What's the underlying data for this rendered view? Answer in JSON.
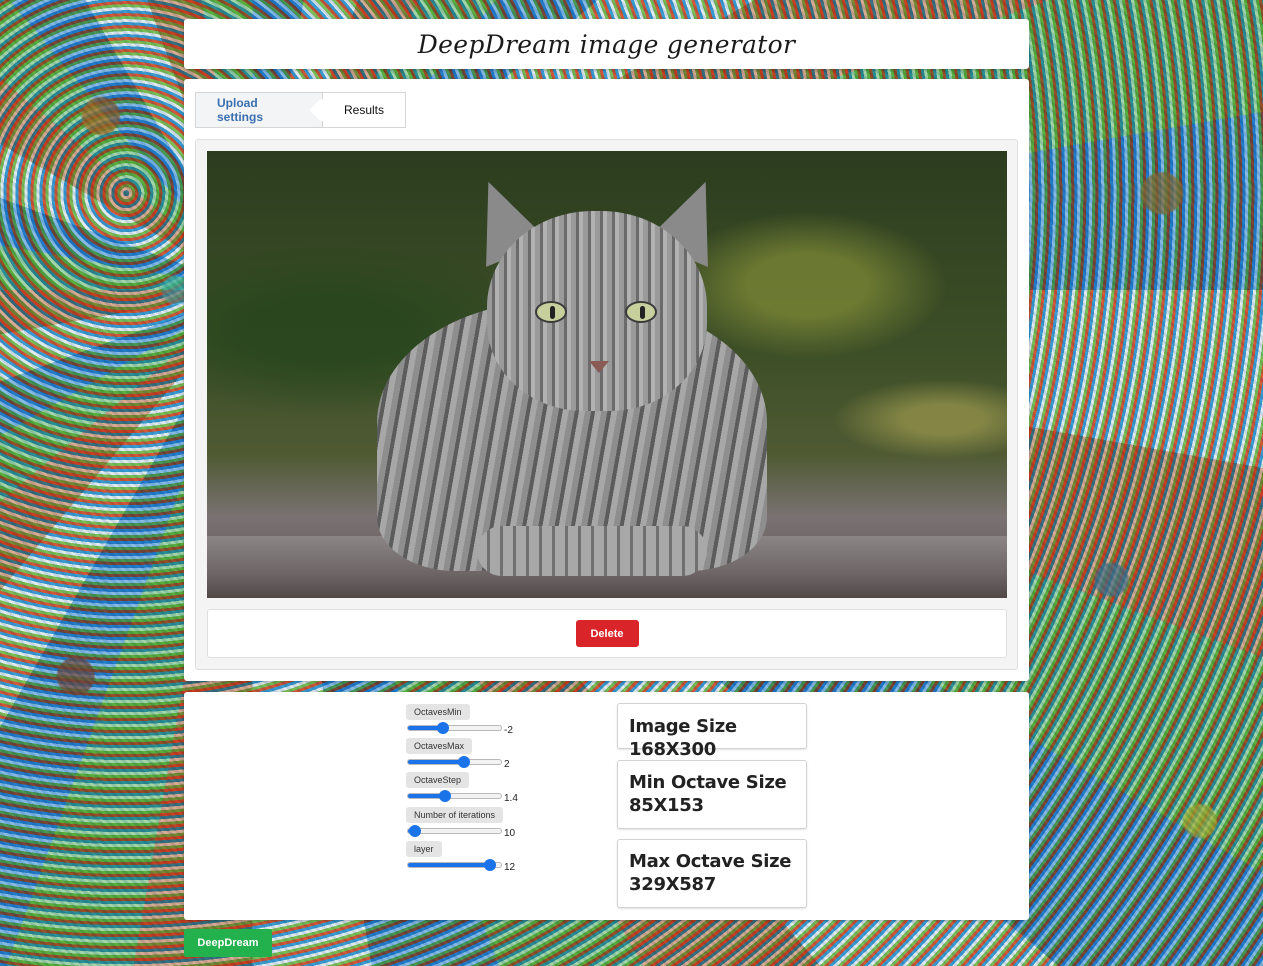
{
  "app": {
    "title": "DeepDream image generator"
  },
  "tabs": [
    {
      "label": "Upload settings",
      "active": true
    },
    {
      "label": "Results",
      "active": false
    }
  ],
  "preview": {
    "image_alt": "Tabby cat photo",
    "delete_label": "Delete"
  },
  "sliders": [
    {
      "label": "OctavesMin",
      "value": "-2",
      "fraction": 0.38
    },
    {
      "label": "OctavesMax",
      "value": "2",
      "fraction": 0.6
    },
    {
      "label": "OctaveStep",
      "value": "1.4",
      "fraction": 0.4
    },
    {
      "label": "Number of iterations",
      "value": "10",
      "fraction": 0.08
    },
    {
      "label": "layer",
      "value": "12",
      "fraction": 0.88
    }
  ],
  "info": {
    "image_size": "Image Size 168X300",
    "min_octave_size": "Min Octave Size 85X153",
    "max_octave_size": "Max Octave Size 329X587"
  },
  "actions": {
    "deepdream_label": "DeepDream"
  },
  "colors": {
    "accent": "#1a73e8",
    "delete": "#d9252a",
    "run": "#22b14c",
    "tab_active": "#3a6fb0"
  }
}
